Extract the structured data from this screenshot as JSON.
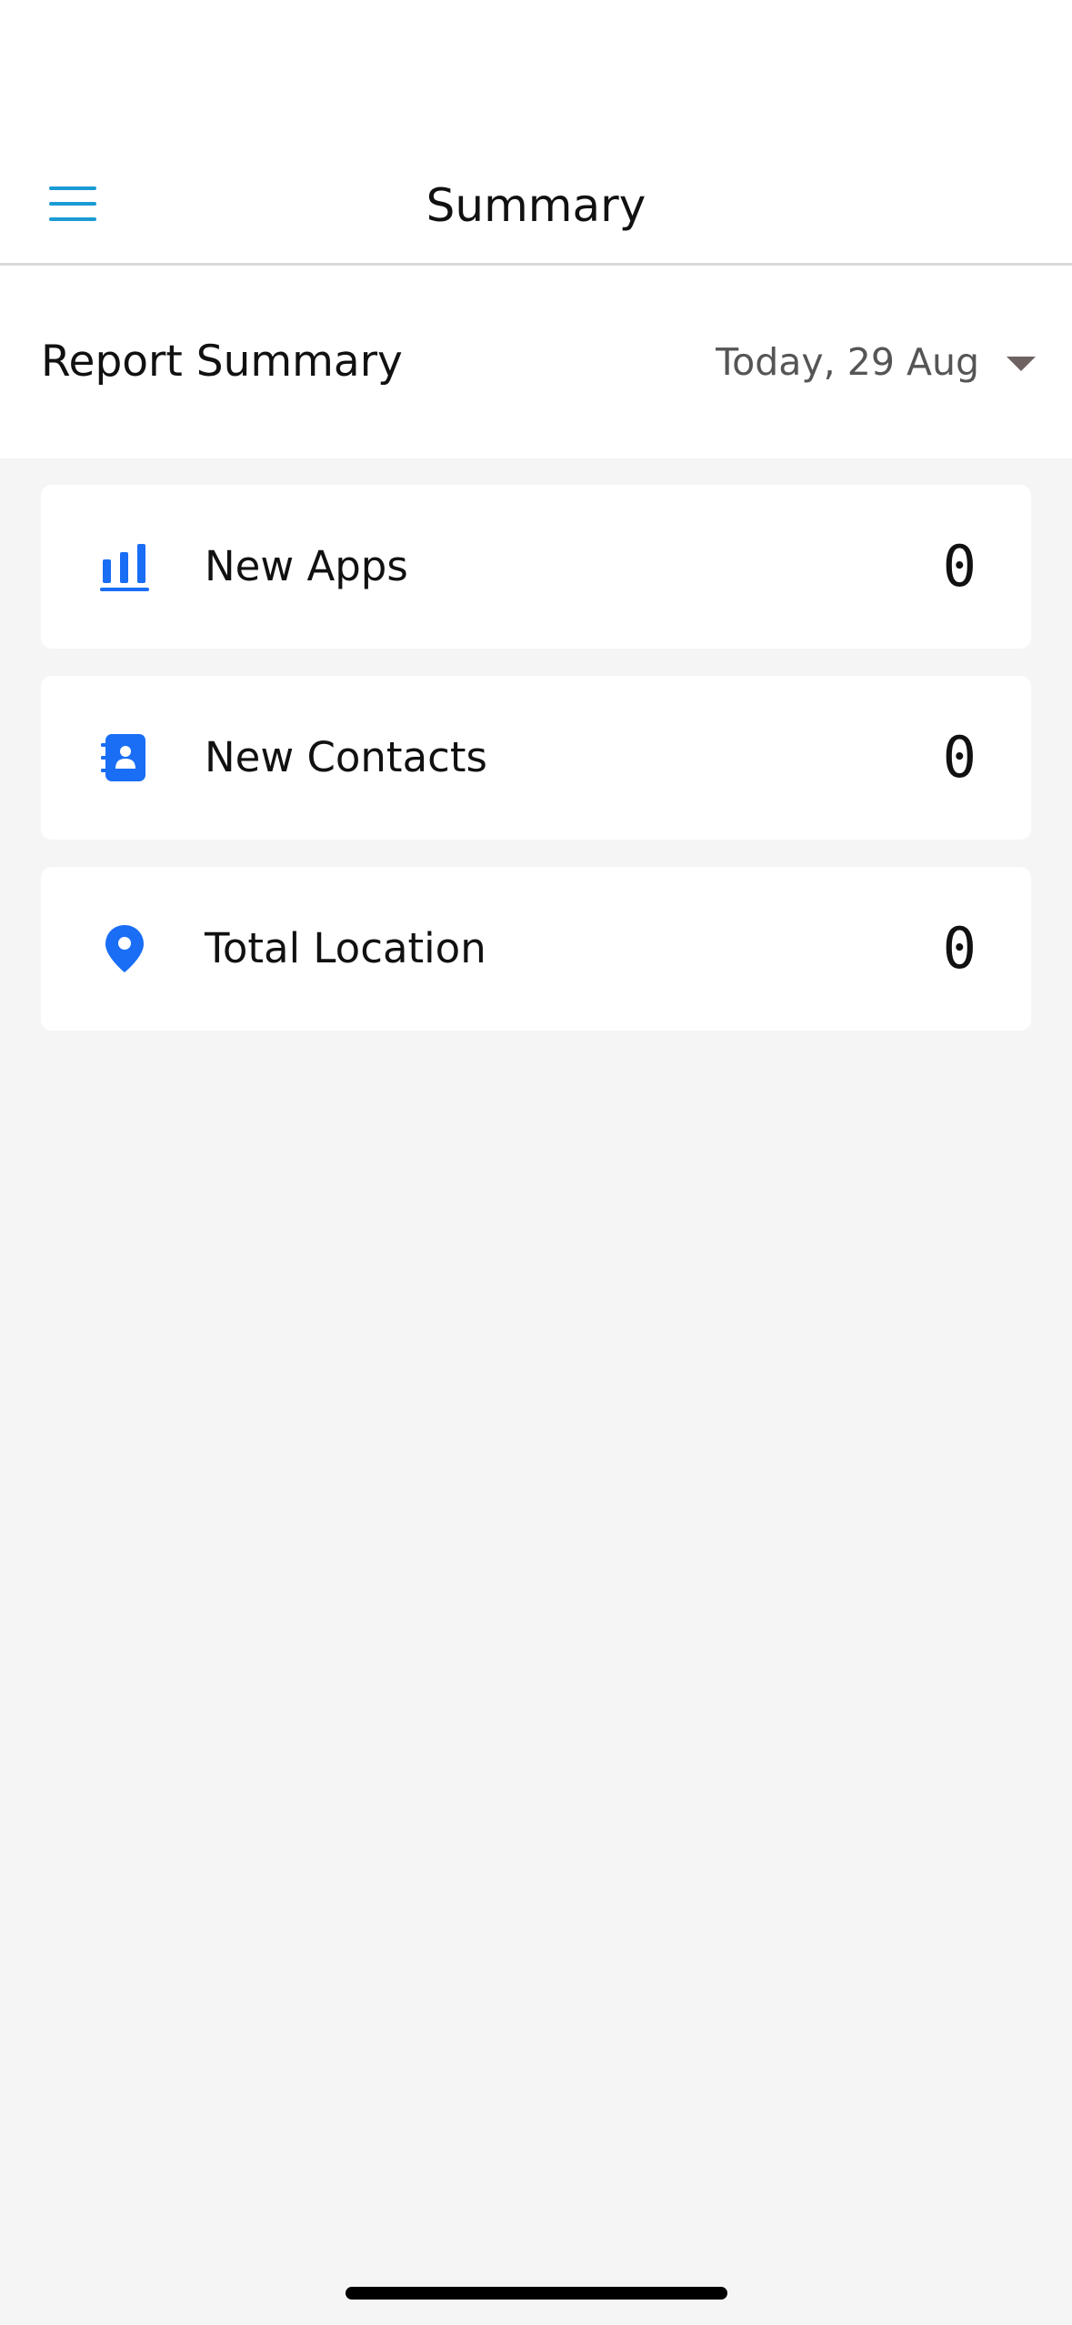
{
  "navbar": {
    "title": "Summary",
    "menu_icon": "hamburger-menu-icon"
  },
  "report": {
    "title": "Report Summary",
    "date_label": "Today, 29 Aug"
  },
  "cards": [
    {
      "label": "New Apps",
      "value": "0",
      "icon": "bar-chart-icon"
    },
    {
      "label": "New Contacts",
      "value": "0",
      "icon": "contact-book-icon"
    },
    {
      "label": "Total Location",
      "value": "0",
      "icon": "location-pin-icon"
    }
  ],
  "colors": {
    "accent": "#1a9bd4",
    "icon_blue": "#1a6ef5",
    "caret": "#6e6262",
    "background": "#f5f5f5"
  }
}
